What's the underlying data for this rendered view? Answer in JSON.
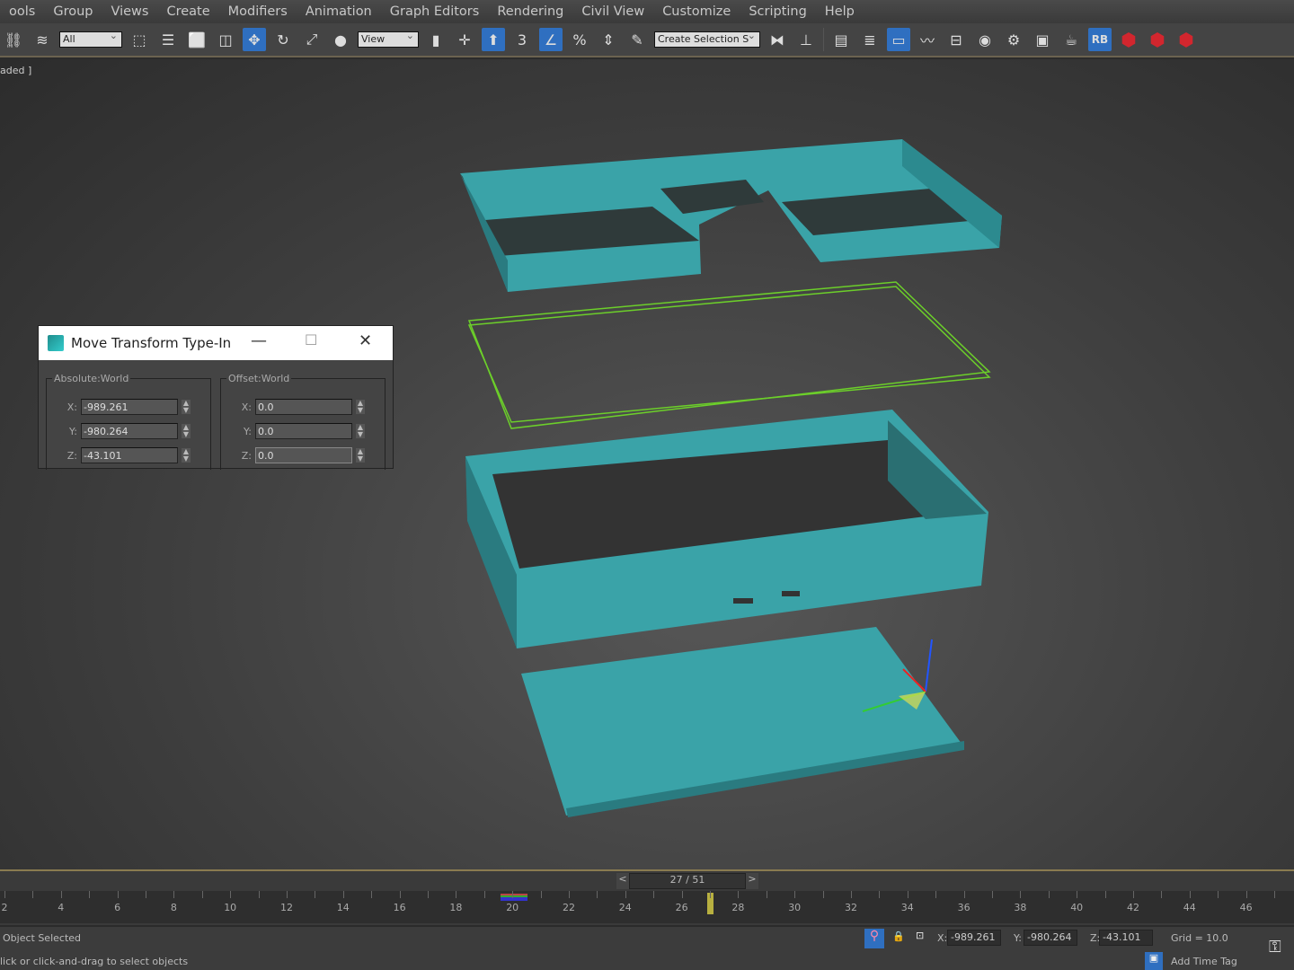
{
  "menu": [
    "ools",
    "Group",
    "Views",
    "Create",
    "Modifiers",
    "Animation",
    "Graph Editors",
    "Rendering",
    "Civil View",
    "Customize",
    "Scripting",
    "Help"
  ],
  "toolbar": {
    "selection_filter": "All",
    "ref_coord": "View",
    "named_selection": "Create Selection S",
    "snap_label": "3",
    "percent_label": "%",
    "rb_label": "RB",
    "accent": "#2f6fc0"
  },
  "viewport": {
    "label": "aded ]",
    "object_color": "#3aa3a8",
    "selected_wire_color": "#6ccf2a"
  },
  "dialog": {
    "title": "Move Transform Type-In",
    "absolute": {
      "legend": "Absolute:World",
      "x_label": "X:",
      "y_label": "Y:",
      "z_label": "Z:",
      "x": "-989.261",
      "y": "-980.264",
      "z": "-43.101"
    },
    "offset": {
      "legend": "Offset:World",
      "x_label": "X:",
      "y_label": "Y:",
      "z_label": "Z:",
      "x": "0.0",
      "y": "0.0",
      "z": "0.0"
    }
  },
  "timeline": {
    "current": "27 / 51",
    "prev": "<",
    "next": ">",
    "ticks": [
      "2",
      "4",
      "6",
      "8",
      "10",
      "12",
      "14",
      "16",
      "18",
      "20",
      "22",
      "24",
      "26",
      "28",
      "30",
      "32",
      "34",
      "36",
      "38",
      "40",
      "42",
      "44",
      "46"
    ],
    "current_frame": 27
  },
  "status": {
    "message": "Object Selected",
    "prompt": "lick or click-and-drag to select objects",
    "x_label": "X:",
    "y_label": "Y:",
    "z_label": "Z:",
    "x": "-989.261",
    "y": "-980.264",
    "z": "-43.101",
    "grid": "Grid = 10.0",
    "add_time_tag": "Add Time Tag"
  }
}
